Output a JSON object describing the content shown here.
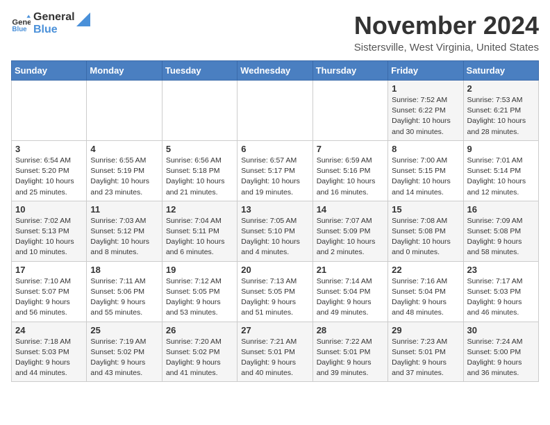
{
  "header": {
    "logo_general": "General",
    "logo_blue": "Blue",
    "month_title": "November 2024",
    "location": "Sistersville, West Virginia, United States"
  },
  "days_of_week": [
    "Sunday",
    "Monday",
    "Tuesday",
    "Wednesday",
    "Thursday",
    "Friday",
    "Saturday"
  ],
  "weeks": [
    [
      {
        "day": "",
        "info": ""
      },
      {
        "day": "",
        "info": ""
      },
      {
        "day": "",
        "info": ""
      },
      {
        "day": "",
        "info": ""
      },
      {
        "day": "",
        "info": ""
      },
      {
        "day": "1",
        "info": "Sunrise: 7:52 AM\nSunset: 6:22 PM\nDaylight: 10 hours and 30 minutes."
      },
      {
        "day": "2",
        "info": "Sunrise: 7:53 AM\nSunset: 6:21 PM\nDaylight: 10 hours and 28 minutes."
      }
    ],
    [
      {
        "day": "3",
        "info": "Sunrise: 6:54 AM\nSunset: 5:20 PM\nDaylight: 10 hours and 25 minutes."
      },
      {
        "day": "4",
        "info": "Sunrise: 6:55 AM\nSunset: 5:19 PM\nDaylight: 10 hours and 23 minutes."
      },
      {
        "day": "5",
        "info": "Sunrise: 6:56 AM\nSunset: 5:18 PM\nDaylight: 10 hours and 21 minutes."
      },
      {
        "day": "6",
        "info": "Sunrise: 6:57 AM\nSunset: 5:17 PM\nDaylight: 10 hours and 19 minutes."
      },
      {
        "day": "7",
        "info": "Sunrise: 6:59 AM\nSunset: 5:16 PM\nDaylight: 10 hours and 16 minutes."
      },
      {
        "day": "8",
        "info": "Sunrise: 7:00 AM\nSunset: 5:15 PM\nDaylight: 10 hours and 14 minutes."
      },
      {
        "day": "9",
        "info": "Sunrise: 7:01 AM\nSunset: 5:14 PM\nDaylight: 10 hours and 12 minutes."
      }
    ],
    [
      {
        "day": "10",
        "info": "Sunrise: 7:02 AM\nSunset: 5:13 PM\nDaylight: 10 hours and 10 minutes."
      },
      {
        "day": "11",
        "info": "Sunrise: 7:03 AM\nSunset: 5:12 PM\nDaylight: 10 hours and 8 minutes."
      },
      {
        "day": "12",
        "info": "Sunrise: 7:04 AM\nSunset: 5:11 PM\nDaylight: 10 hours and 6 minutes."
      },
      {
        "day": "13",
        "info": "Sunrise: 7:05 AM\nSunset: 5:10 PM\nDaylight: 10 hours and 4 minutes."
      },
      {
        "day": "14",
        "info": "Sunrise: 7:07 AM\nSunset: 5:09 PM\nDaylight: 10 hours and 2 minutes."
      },
      {
        "day": "15",
        "info": "Sunrise: 7:08 AM\nSunset: 5:08 PM\nDaylight: 10 hours and 0 minutes."
      },
      {
        "day": "16",
        "info": "Sunrise: 7:09 AM\nSunset: 5:08 PM\nDaylight: 9 hours and 58 minutes."
      }
    ],
    [
      {
        "day": "17",
        "info": "Sunrise: 7:10 AM\nSunset: 5:07 PM\nDaylight: 9 hours and 56 minutes."
      },
      {
        "day": "18",
        "info": "Sunrise: 7:11 AM\nSunset: 5:06 PM\nDaylight: 9 hours and 55 minutes."
      },
      {
        "day": "19",
        "info": "Sunrise: 7:12 AM\nSunset: 5:05 PM\nDaylight: 9 hours and 53 minutes."
      },
      {
        "day": "20",
        "info": "Sunrise: 7:13 AM\nSunset: 5:05 PM\nDaylight: 9 hours and 51 minutes."
      },
      {
        "day": "21",
        "info": "Sunrise: 7:14 AM\nSunset: 5:04 PM\nDaylight: 9 hours and 49 minutes."
      },
      {
        "day": "22",
        "info": "Sunrise: 7:16 AM\nSunset: 5:04 PM\nDaylight: 9 hours and 48 minutes."
      },
      {
        "day": "23",
        "info": "Sunrise: 7:17 AM\nSunset: 5:03 PM\nDaylight: 9 hours and 46 minutes."
      }
    ],
    [
      {
        "day": "24",
        "info": "Sunrise: 7:18 AM\nSunset: 5:03 PM\nDaylight: 9 hours and 44 minutes."
      },
      {
        "day": "25",
        "info": "Sunrise: 7:19 AM\nSunset: 5:02 PM\nDaylight: 9 hours and 43 minutes."
      },
      {
        "day": "26",
        "info": "Sunrise: 7:20 AM\nSunset: 5:02 PM\nDaylight: 9 hours and 41 minutes."
      },
      {
        "day": "27",
        "info": "Sunrise: 7:21 AM\nSunset: 5:01 PM\nDaylight: 9 hours and 40 minutes."
      },
      {
        "day": "28",
        "info": "Sunrise: 7:22 AM\nSunset: 5:01 PM\nDaylight: 9 hours and 39 minutes."
      },
      {
        "day": "29",
        "info": "Sunrise: 7:23 AM\nSunset: 5:01 PM\nDaylight: 9 hours and 37 minutes."
      },
      {
        "day": "30",
        "info": "Sunrise: 7:24 AM\nSunset: 5:00 PM\nDaylight: 9 hours and 36 minutes."
      }
    ]
  ]
}
